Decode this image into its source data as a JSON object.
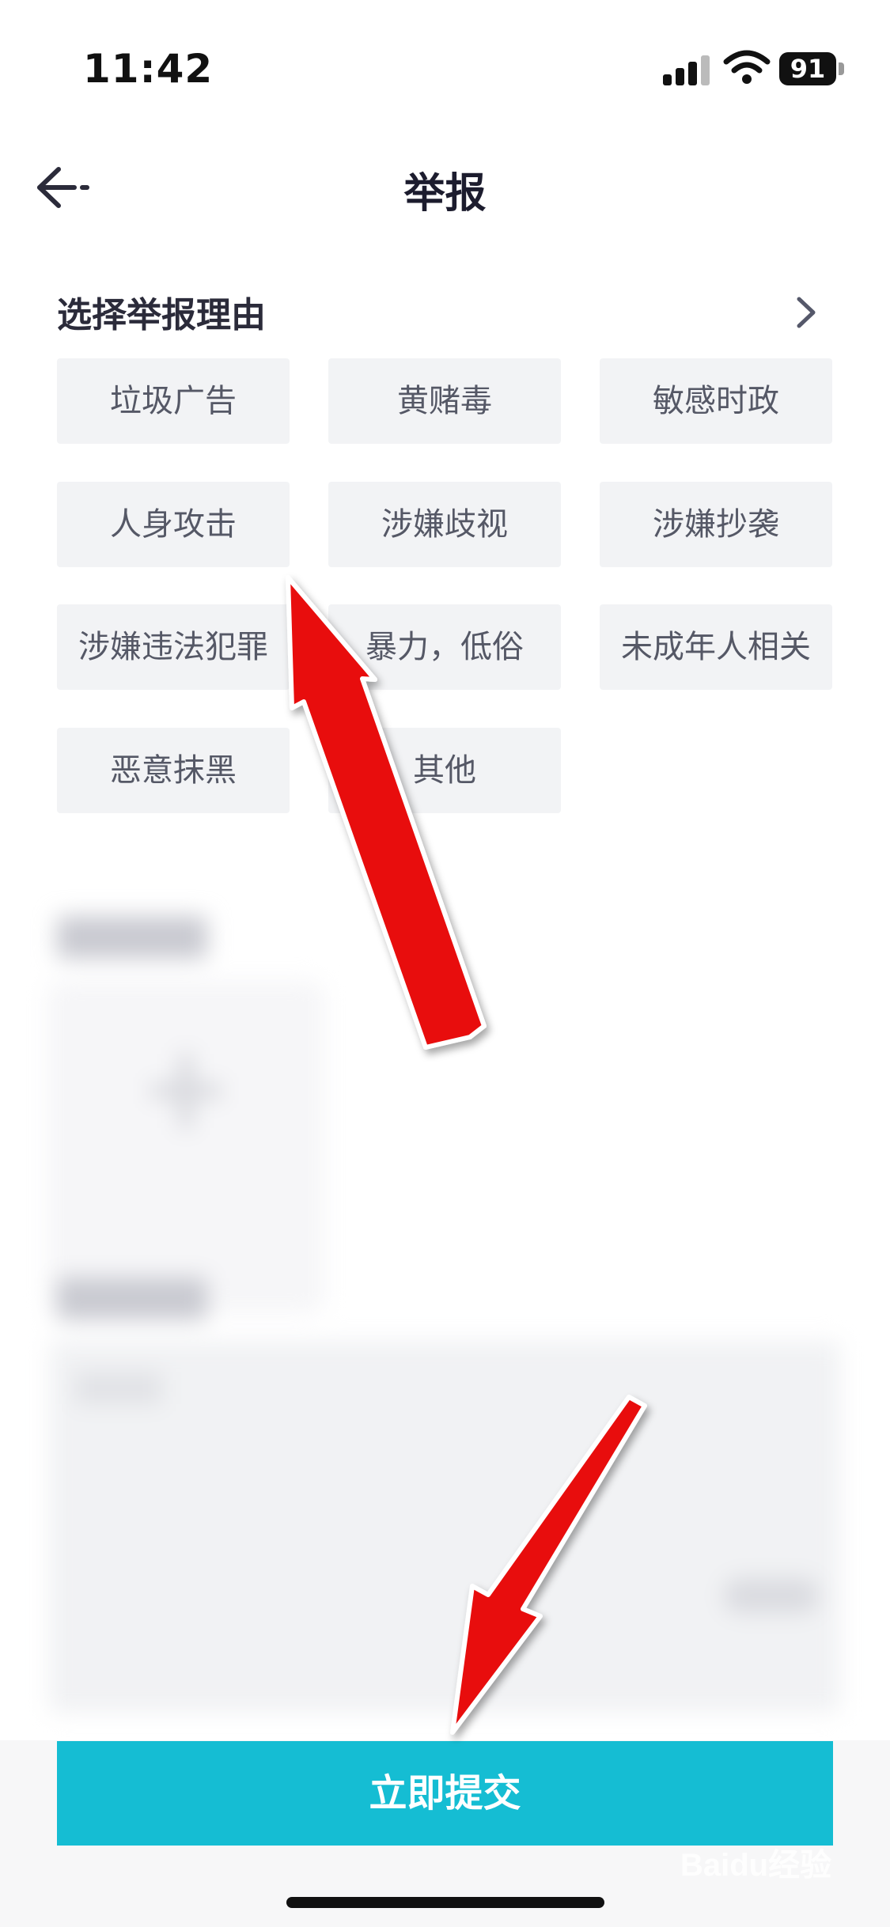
{
  "status_bar": {
    "time": "11:42",
    "battery": "91"
  },
  "nav": {
    "title": "举报"
  },
  "section": {
    "title": "选择举报理由"
  },
  "reasons": [
    "垃圾广告",
    "黄赌毒",
    "敏感时政",
    "人身攻击",
    "涉嫌歧视",
    "涉嫌抄袭",
    "涉嫌违法犯罪",
    "暴力，低俗",
    "未成年人相关",
    "恶意抹黑",
    "其他"
  ],
  "footer": {
    "submit_label": "立即提交",
    "watermark": "Baidu经验"
  },
  "colors": {
    "accent": "#15bdd3",
    "chip_bg": "#f2f3f5",
    "annotation_arrow": "#e81010"
  },
  "icons": [
    "back-arrow-icon",
    "chevron-right-icon",
    "signal-icon",
    "wifi-icon",
    "battery-icon"
  ]
}
